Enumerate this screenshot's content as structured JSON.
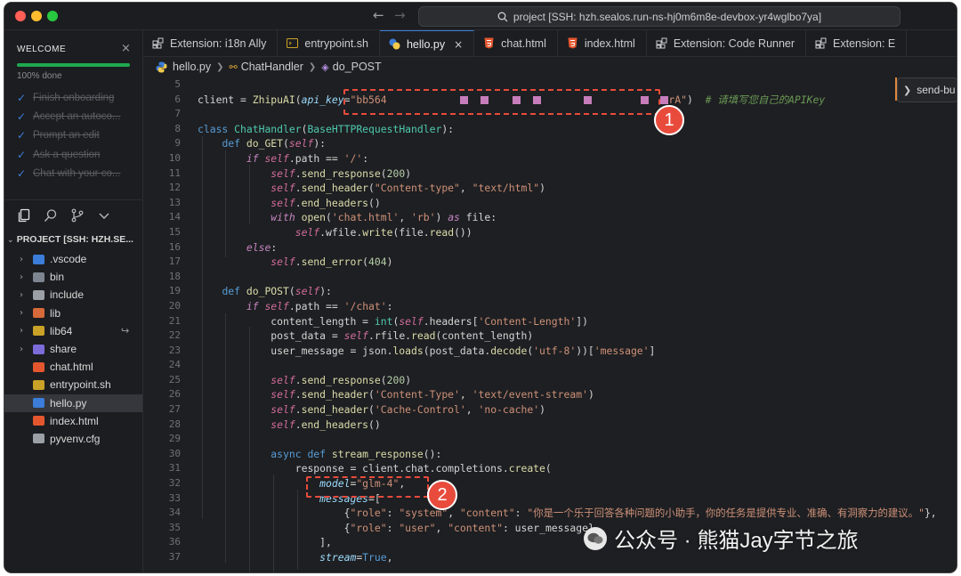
{
  "titlebar": {
    "command_center": "project [SSH: hzh.sealos.run-ns-hj0m6m8e-devbox-yr4wglbo7ya]",
    "colors": {
      "close": "#ff5f57",
      "minimize": "#febc2e",
      "maximize": "#28c840"
    }
  },
  "welcome": {
    "title": "WELCOME",
    "progress_text": "100% done",
    "progress_fraction": 1.0,
    "steps": [
      "Finish onboarding",
      "Accept an autoco...",
      "Prompt an edit",
      "Ask a question",
      "Chat with your co..."
    ]
  },
  "explorer": {
    "project_label": "PROJECT [SSH: HZH.SE...",
    "items": [
      {
        "name": ".vscode",
        "type": "folder",
        "color": "#3b7dd8"
      },
      {
        "name": "bin",
        "type": "folder",
        "color": "#7d8590"
      },
      {
        "name": "include",
        "type": "folder",
        "color": "#9aa0a6"
      },
      {
        "name": "lib",
        "type": "folder",
        "color": "#d66a3a"
      },
      {
        "name": "lib64",
        "type": "folder",
        "color": "#c9a227",
        "extra": "↪"
      },
      {
        "name": "share",
        "type": "folder",
        "color": "#7b6cd9"
      },
      {
        "name": "chat.html",
        "type": "file",
        "color": "#e4572e"
      },
      {
        "name": "entrypoint.sh",
        "type": "file",
        "color": "#c9a227"
      },
      {
        "name": "hello.py",
        "type": "file",
        "color": "#3b7dd8",
        "selected": true
      },
      {
        "name": "index.html",
        "type": "file",
        "color": "#e4572e"
      },
      {
        "name": "pyvenv.cfg",
        "type": "file",
        "color": "#9aa0a6"
      }
    ]
  },
  "tabs": [
    {
      "label": "Extension: i18n Ally",
      "icon": "extension-icon"
    },
    {
      "label": "entrypoint.sh",
      "icon": "terminal-icon"
    },
    {
      "label": "hello.py",
      "icon": "python-icon",
      "active": true,
      "close": "×"
    },
    {
      "label": "chat.html",
      "icon": "html5-icon"
    },
    {
      "label": "index.html",
      "icon": "html5-icon"
    },
    {
      "label": "Extension: Code Runner",
      "icon": "extension-icon"
    },
    {
      "label": "Extension: E",
      "icon": "extension-icon"
    }
  ],
  "breadcrumb": [
    "hello.py",
    "ChatHandler",
    "do_POST"
  ],
  "editor": {
    "line_numbers": [
      "5",
      "6",
      "7",
      "8",
      "9",
      "10",
      "11",
      "12",
      "13",
      "14",
      "15",
      "16",
      "17",
      "18",
      "19",
      "20",
      "21",
      "22",
      "23",
      "24",
      "25",
      "26",
      "27",
      "28",
      "29",
      "30",
      "31",
      "32",
      "33",
      "34",
      "35",
      "36",
      "37"
    ]
  },
  "send_button": "send-bu",
  "annotations": [
    "1",
    "2"
  ],
  "watermark": "公众号 · 熊猫Jay字节之旅"
}
